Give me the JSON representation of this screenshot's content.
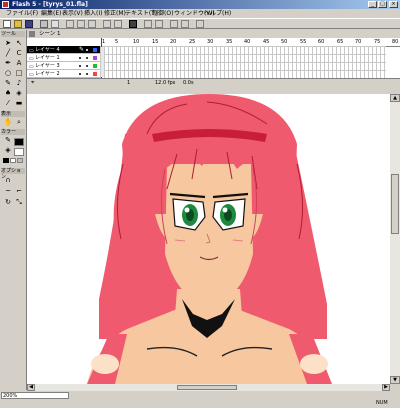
{
  "window": {
    "title": "Flash 5 - [tyrys_01.fla]",
    "buttons": [
      "_",
      "□",
      "×"
    ]
  },
  "menu": {
    "items": [
      "ファイル(F)",
      "編集(E)",
      "表示(V)",
      "挿入(I)",
      "修正(M)",
      "テキスト(T)",
      "制御(O)",
      "ウィンドウ(W)",
      "ヘルプ(H)"
    ]
  },
  "tools": {
    "header": "ツール",
    "view_header": "表示",
    "color_header": "カラー",
    "options_header": "オプション"
  },
  "timeline": {
    "scene": "シーン 1",
    "ruler": [
      "1",
      "5",
      "10",
      "15",
      "20",
      "25",
      "30",
      "35",
      "40",
      "45",
      "50",
      "55",
      "60",
      "65",
      "70",
      "75",
      "80",
      "85"
    ],
    "layers": [
      {
        "name": "レイヤー 4",
        "color": "#3060ff"
      },
      {
        "name": "レイヤー 1",
        "color": "#c040c0"
      },
      {
        "name": "レイヤー 3",
        "color": "#20c020"
      },
      {
        "name": "レイヤー 2",
        "color": "#ff4040"
      }
    ],
    "status": {
      "frame": "1",
      "fps": "12.0 fps",
      "time": "0.0s"
    }
  },
  "bottom": {
    "zoom": "200%",
    "num": "NUM"
  }
}
